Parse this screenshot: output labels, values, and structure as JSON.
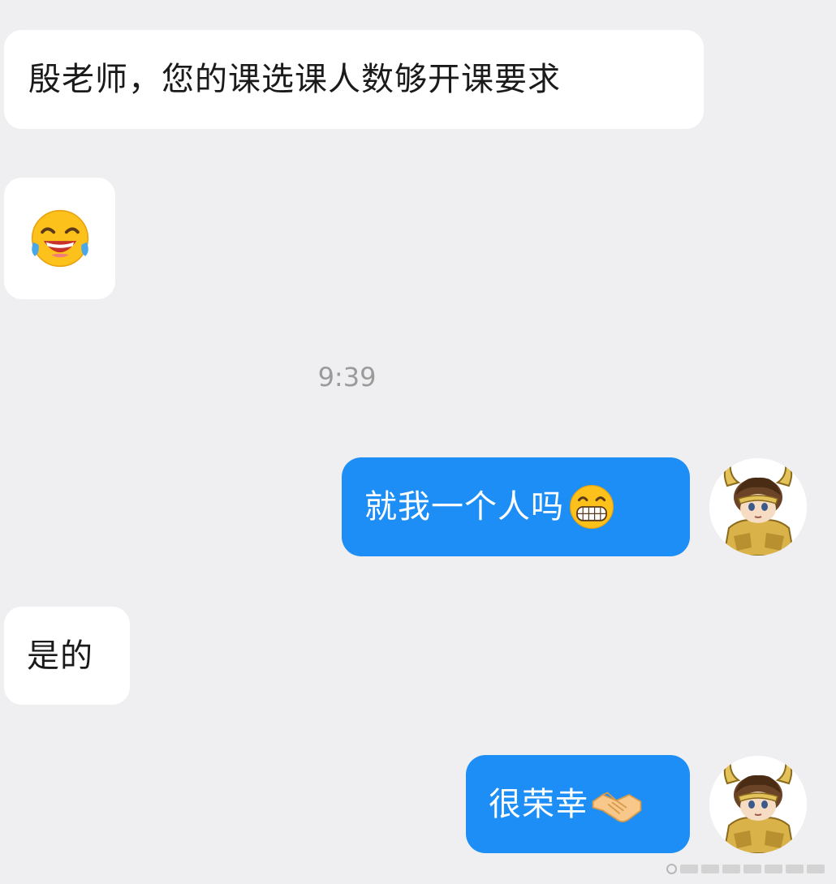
{
  "conversation": {
    "messages": [
      {
        "direction": "incoming",
        "text": "殷老师，您的课选课人数够开课要求",
        "emoji": null
      },
      {
        "direction": "incoming",
        "text": "",
        "emoji": "tears-of-joy-emoji"
      },
      {
        "direction": "outgoing",
        "text": "就我一个人吗",
        "emoji": "grinning-emoji"
      },
      {
        "direction": "incoming",
        "text": "是的",
        "emoji": null
      },
      {
        "direction": "outgoing",
        "text": "很荣幸",
        "emoji": "handshake-emoji"
      }
    ],
    "timestamp": "9:39"
  },
  "colors": {
    "background": "#efeff1",
    "incoming_bubble": "#ffffff",
    "outgoing_bubble": "#1d8ef6",
    "timestamp_text": "#9a9a9a"
  },
  "icons": {
    "avatar": "anime-gold-armor-avatar",
    "watermark": "weibo-watermark-icon"
  }
}
